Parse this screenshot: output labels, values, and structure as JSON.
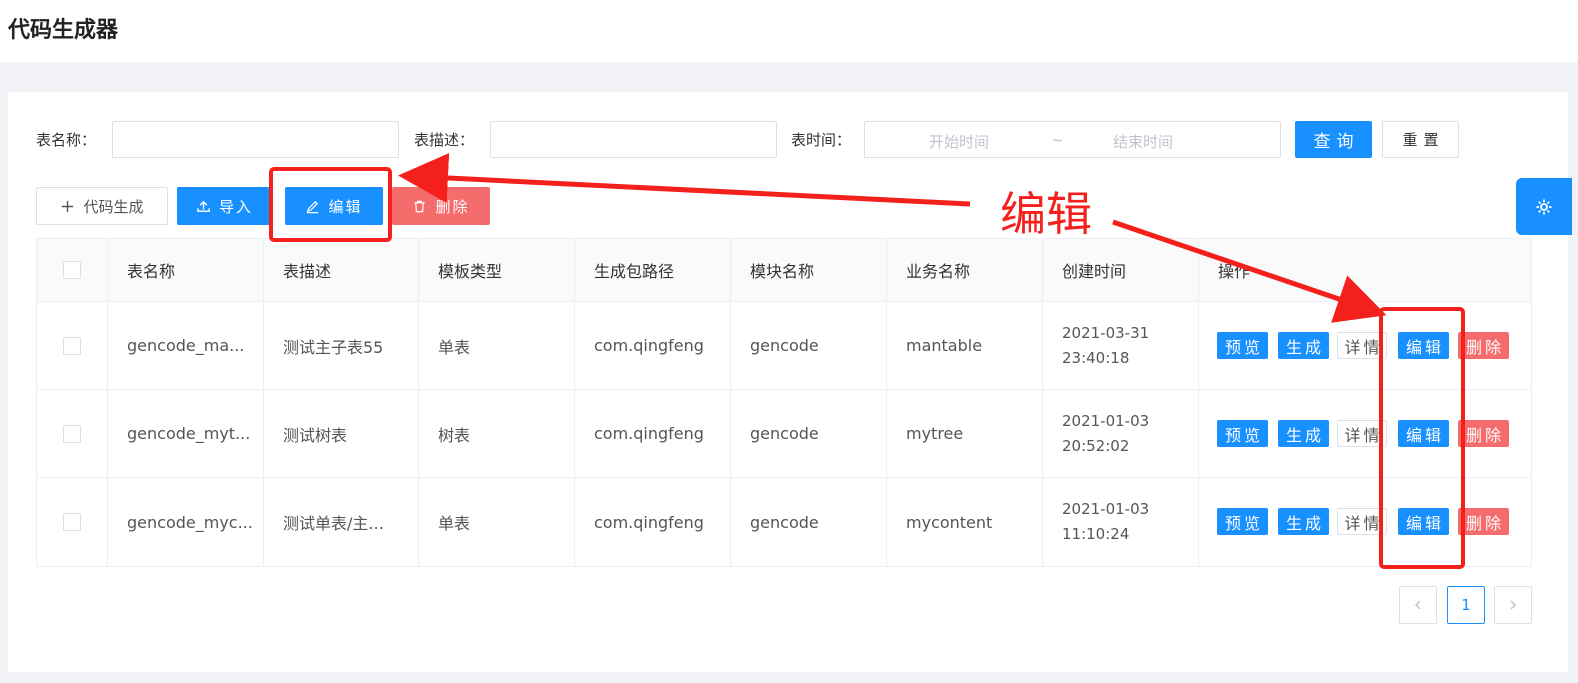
{
  "header": {
    "title": "代码生成器"
  },
  "search": {
    "table_name_label": "表名称：",
    "table_desc_label": "表描述：",
    "table_time_label": "表时间：",
    "start_placeholder": "开始时间",
    "range_separator": "~",
    "end_placeholder": "结束时间",
    "query_label": "查询",
    "reset_label": "重置"
  },
  "toolbar": {
    "generate_label": "代码生成",
    "import_label": "导入",
    "edit_label": "编辑",
    "delete_label": "删除"
  },
  "table": {
    "columns": [
      "表名称",
      "表描述",
      "模板类型",
      "生成包路径",
      "模块名称",
      "业务名称",
      "创建时间",
      "操作"
    ],
    "rows": [
      {
        "name": "gencode_ma...",
        "desc": "测试主子表55",
        "template": "单表",
        "package": "com.qingfeng",
        "module": "gencode",
        "business": "mantable",
        "date": "2021-03-31",
        "time": "23:40:18"
      },
      {
        "name": "gencode_myt...",
        "desc": "测试树表",
        "template": "树表",
        "package": "com.qingfeng",
        "module": "gencode",
        "business": "mytree",
        "date": "2021-01-03",
        "time": "20:52:02"
      },
      {
        "name": "gencode_myc...",
        "desc": "测试单表/主...",
        "template": "单表",
        "package": "com.qingfeng",
        "module": "gencode",
        "business": "mycontent",
        "date": "2021-01-03",
        "time": "11:10:24"
      }
    ],
    "actions": {
      "preview": "预览",
      "generate": "生成",
      "detail": "详情",
      "edit": "编辑",
      "delete": "删除"
    }
  },
  "pagination": {
    "current": "1",
    "prev_icon": "chevron-left-icon",
    "next_icon": "chevron-right-icon"
  },
  "annotation": {
    "text": "编辑",
    "color": "#f3201b"
  },
  "colors": {
    "primary": "#1890ff",
    "danger": "#f56c6c"
  }
}
